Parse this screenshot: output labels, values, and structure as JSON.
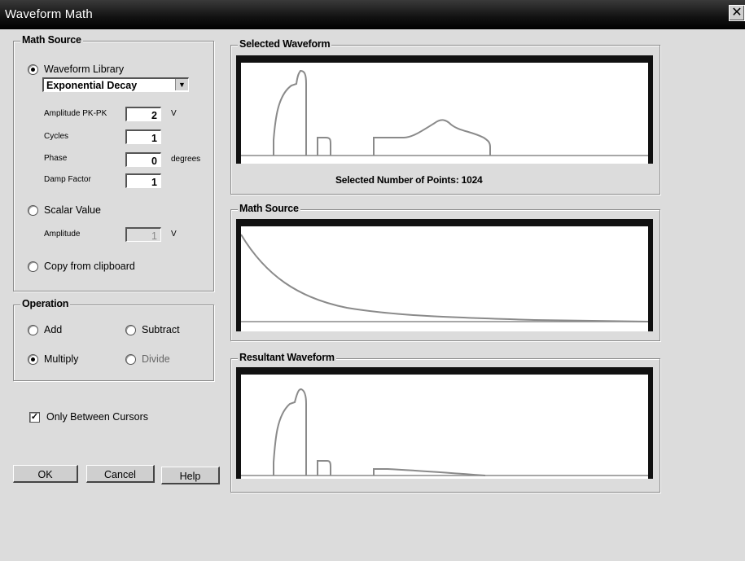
{
  "window": {
    "title": "Waveform Math",
    "close_icon": "close-icon"
  },
  "math_source": {
    "group_label": "Math Source",
    "waveform_library": {
      "label": "Waveform Library",
      "selected": true,
      "select_value": "Exponential Decay",
      "params": [
        {
          "label": "Amplitude PK-PK",
          "value": "2",
          "unit": "V"
        },
        {
          "label": "Cycles",
          "value": "1",
          "unit": ""
        },
        {
          "label": "Phase",
          "value": "0",
          "unit": "degrees"
        },
        {
          "label": "Damp Factor",
          "value": "1",
          "unit": ""
        }
      ]
    },
    "scalar_value": {
      "label": "Scalar Value",
      "selected": false,
      "amplitude_label": "Amplitude",
      "amplitude_value": "1",
      "amplitude_unit": "V"
    },
    "clipboard": {
      "label": "Copy from clipboard",
      "selected": false
    }
  },
  "operation": {
    "group_label": "Operation",
    "options": [
      {
        "label": "Add",
        "selected": false
      },
      {
        "label": "Subtract",
        "selected": false
      },
      {
        "label": "Multiply",
        "selected": true
      },
      {
        "label": "Divide",
        "selected": false
      }
    ]
  },
  "only_between_cursors": {
    "label": "Only Between Cursors",
    "checked": true
  },
  "buttons": {
    "ok": "OK",
    "cancel": "Cancel",
    "help": "Help"
  },
  "selected_waveform": {
    "group_label": "Selected Waveform",
    "points_text": "Selected Number of Points: 1024"
  },
  "math_source_plot": {
    "group_label": "Math Source"
  },
  "resultant_waveform": {
    "group_label": "Resultant Waveform"
  },
  "colors": {
    "trace": "#8a8a8a",
    "plot_frame": "#111111",
    "background": "#dcdcdc"
  }
}
